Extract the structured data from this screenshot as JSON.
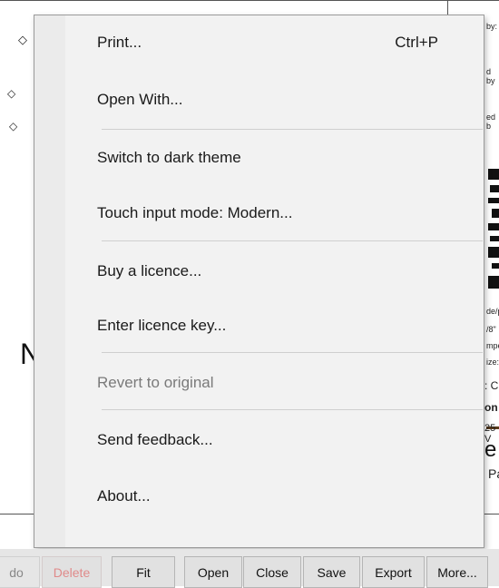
{
  "document": {
    "fragments": [
      "by:",
      "d by",
      "ed b",
      "de/p",
      "/8\"",
      "mpe",
      "ize:",
      ": C",
      "on",
      "25 V",
      "e",
      "Pa",
      "N"
    ]
  },
  "menu": {
    "items": [
      {
        "label": "Print...",
        "shortcut": "Ctrl+P"
      },
      {
        "label": "Open With..."
      },
      {
        "label": "Switch to dark theme"
      },
      {
        "label": "Touch input mode: Modern..."
      },
      {
        "label": "Buy a licence..."
      },
      {
        "label": "Enter licence key..."
      },
      {
        "label": "Revert to original",
        "disabled": true
      },
      {
        "label": "Send feedback..."
      },
      {
        "label": "About..."
      }
    ]
  },
  "toolbar": {
    "undo": "do",
    "delete": "Delete",
    "fit": "Fit",
    "open": "Open",
    "close": "Close",
    "save": "Save",
    "export": "Export",
    "more": "More..."
  }
}
